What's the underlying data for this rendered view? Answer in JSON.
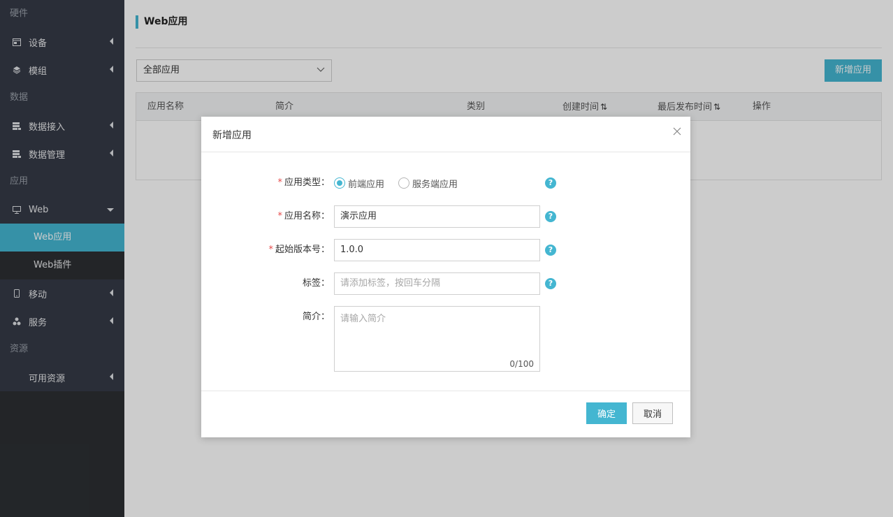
{
  "sidebar": {
    "sections": {
      "hardware": "硬件",
      "data": "数据",
      "apps": "应用",
      "resources": "资源"
    },
    "items": {
      "device": "设备",
      "module": "模组",
      "data_access": "数据接入",
      "data_management": "数据管理",
      "web": "Web",
      "web_apps": "Web应用",
      "web_plugins": "Web插件",
      "mobile": "移动",
      "service": "服务",
      "available_resources": "可用资源"
    },
    "icons": {
      "device": "device-icon",
      "module": "layers-icon",
      "data_access": "database-icon",
      "data_management": "database-icon",
      "web": "monitor-icon",
      "mobile": "phone-icon",
      "service": "cluster-icon"
    }
  },
  "page": {
    "title": "Web应用",
    "filter_value": "全部应用",
    "add_button": "新增应用"
  },
  "table": {
    "columns": [
      "应用名称",
      "简介",
      "类别",
      "创建时间",
      "最后发布时间",
      "操作"
    ],
    "sortable": [
      "创建时间",
      "最后发布时间"
    ]
  },
  "modal": {
    "title": "新增应用",
    "fields": {
      "type_label": "应用类型：",
      "type_options": [
        "前端应用",
        "服务端应用"
      ],
      "type_selected": "前端应用",
      "name_label": "应用名称：",
      "name_value": "演示应用",
      "version_label": "起始版本号：",
      "version_value": "1.0.0",
      "tags_label": "标签：",
      "tags_placeholder": "请添加标签，按回车分隔",
      "desc_label": "简介：",
      "desc_placeholder": "请输入简介",
      "desc_counter": "0/100"
    },
    "required_mark": "*",
    "help_mark": "?",
    "ok_button": "确定",
    "cancel_button": "取消"
  },
  "colors": {
    "accent": "#44b6d1",
    "sidebar_bg": "#353a46",
    "required": "#e64a4a"
  }
}
